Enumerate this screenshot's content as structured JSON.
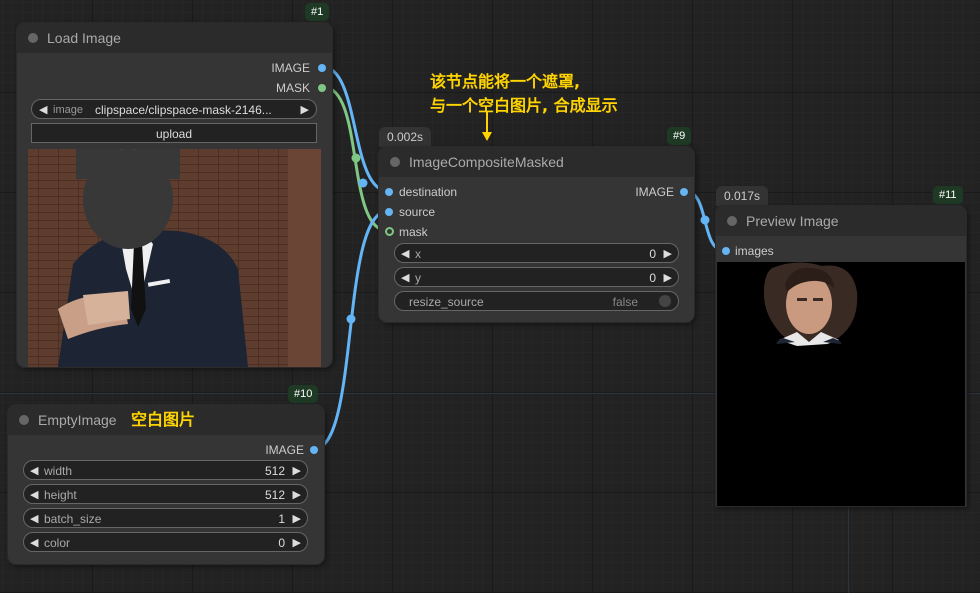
{
  "annotation": {
    "line1": "该节点能将一个遮罩,",
    "line2": "与一个空白图片, 合成显示",
    "empty_label": "空白图片"
  },
  "load_image": {
    "id": "#1",
    "title": "Load Image",
    "outputs": [
      "IMAGE",
      "MASK"
    ],
    "image_widget": {
      "label": "image",
      "value": "clipspace/clipspace-mask-2146..."
    },
    "upload_label": "upload"
  },
  "composite": {
    "id": "#9",
    "time": "0.002s",
    "title": "ImageCompositeMasked",
    "inputs": [
      "destination",
      "source",
      "mask"
    ],
    "output": "IMAGE",
    "widgets": [
      {
        "label": "x",
        "value": "0"
      },
      {
        "label": "y",
        "value": "0"
      }
    ],
    "toggle": {
      "label": "resize_source",
      "value": "false"
    }
  },
  "preview": {
    "id": "#11",
    "time": "0.017s",
    "title": "Preview Image",
    "input": "images"
  },
  "empty_image": {
    "id": "#10",
    "title": "EmptyImage",
    "output": "IMAGE",
    "widgets": [
      {
        "label": "width",
        "value": "512"
      },
      {
        "label": "height",
        "value": "512"
      },
      {
        "label": "batch_size",
        "value": "1"
      },
      {
        "label": "color",
        "value": "0"
      }
    ]
  },
  "colors": {
    "image_link": "#64b5f6",
    "mask_link": "#81c784",
    "annotation": "#ffd400",
    "node_bg": "#353535"
  }
}
